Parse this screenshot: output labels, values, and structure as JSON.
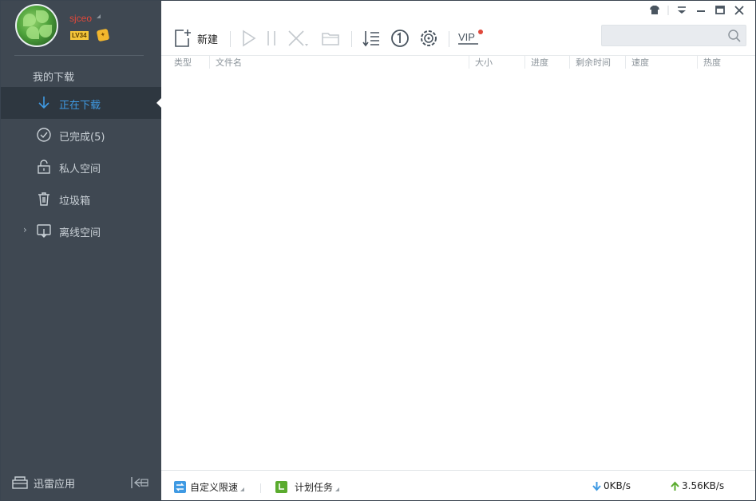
{
  "user": {
    "name": "sjceo",
    "level": "LV34",
    "vip_badge": "VIP"
  },
  "sidebar": {
    "section_title": "我的下载",
    "items": [
      {
        "label": "正在下载",
        "icon": "download-arrow-icon",
        "active": true
      },
      {
        "label": "已完成(5)",
        "icon": "check-circle-icon",
        "active": false
      },
      {
        "label": "私人空间",
        "icon": "lock-icon",
        "active": false
      },
      {
        "label": "垃圾箱",
        "icon": "trash-icon",
        "active": false
      },
      {
        "label": "离线空间",
        "icon": "cloud-download-icon",
        "active": false,
        "expandable": true
      }
    ],
    "bottom": {
      "apps_label": "迅雷应用",
      "apps_icon": "apps-icon",
      "collapse_icon": "collapse-sidebar-icon"
    }
  },
  "toolbar": {
    "new_label": "新建",
    "vip_label": "VIP",
    "buttons": [
      "new-task-icon",
      "play-icon",
      "pause-icon",
      "delete-icon",
      "open-folder-icon",
      "sort-icon",
      "one-task-icon",
      "settings-icon",
      "vip-icon"
    ]
  },
  "search": {
    "placeholder": ""
  },
  "table": {
    "columns": [
      "类型",
      "文件名",
      "大小",
      "进度",
      "剩余时间",
      "速度",
      "热度"
    ]
  },
  "status": {
    "speed_limit_label": "自定义限速",
    "schedule_label": "计划任务",
    "download_speed": "0KB/s",
    "upload_speed": "3.56KB/s"
  },
  "colors": {
    "sidebar_bg": "#3f4852",
    "sidebar_active_bg": "#2e3740",
    "accent_blue": "#3f9ae3",
    "username_red": "#e0483b",
    "upload_green": "#5aab2e"
  }
}
